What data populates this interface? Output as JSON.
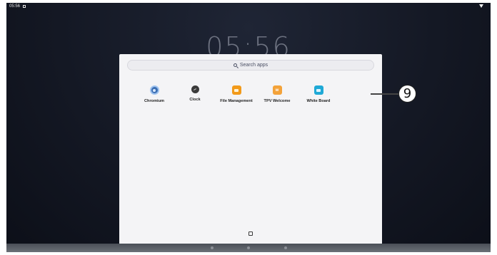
{
  "status_bar": {
    "time": "05:56"
  },
  "lock_clock": "05:56",
  "drawer": {
    "search_placeholder": "Search apps",
    "apps": [
      {
        "label": "Chromium",
        "icon": "chromium-icon"
      },
      {
        "label": "Clock",
        "icon": "clock-icon"
      },
      {
        "label": "File Management",
        "icon": "folder-icon"
      },
      {
        "label": "TPV Welcome",
        "icon": "tpv-icon"
      },
      {
        "label": "White Board",
        "icon": "whiteboard-icon"
      }
    ]
  },
  "callout": {
    "number": "9"
  },
  "colors": {
    "drawer_bg": "#f4f4f6",
    "screen_bg": "#141824",
    "accent": "#3c6fb4"
  }
}
